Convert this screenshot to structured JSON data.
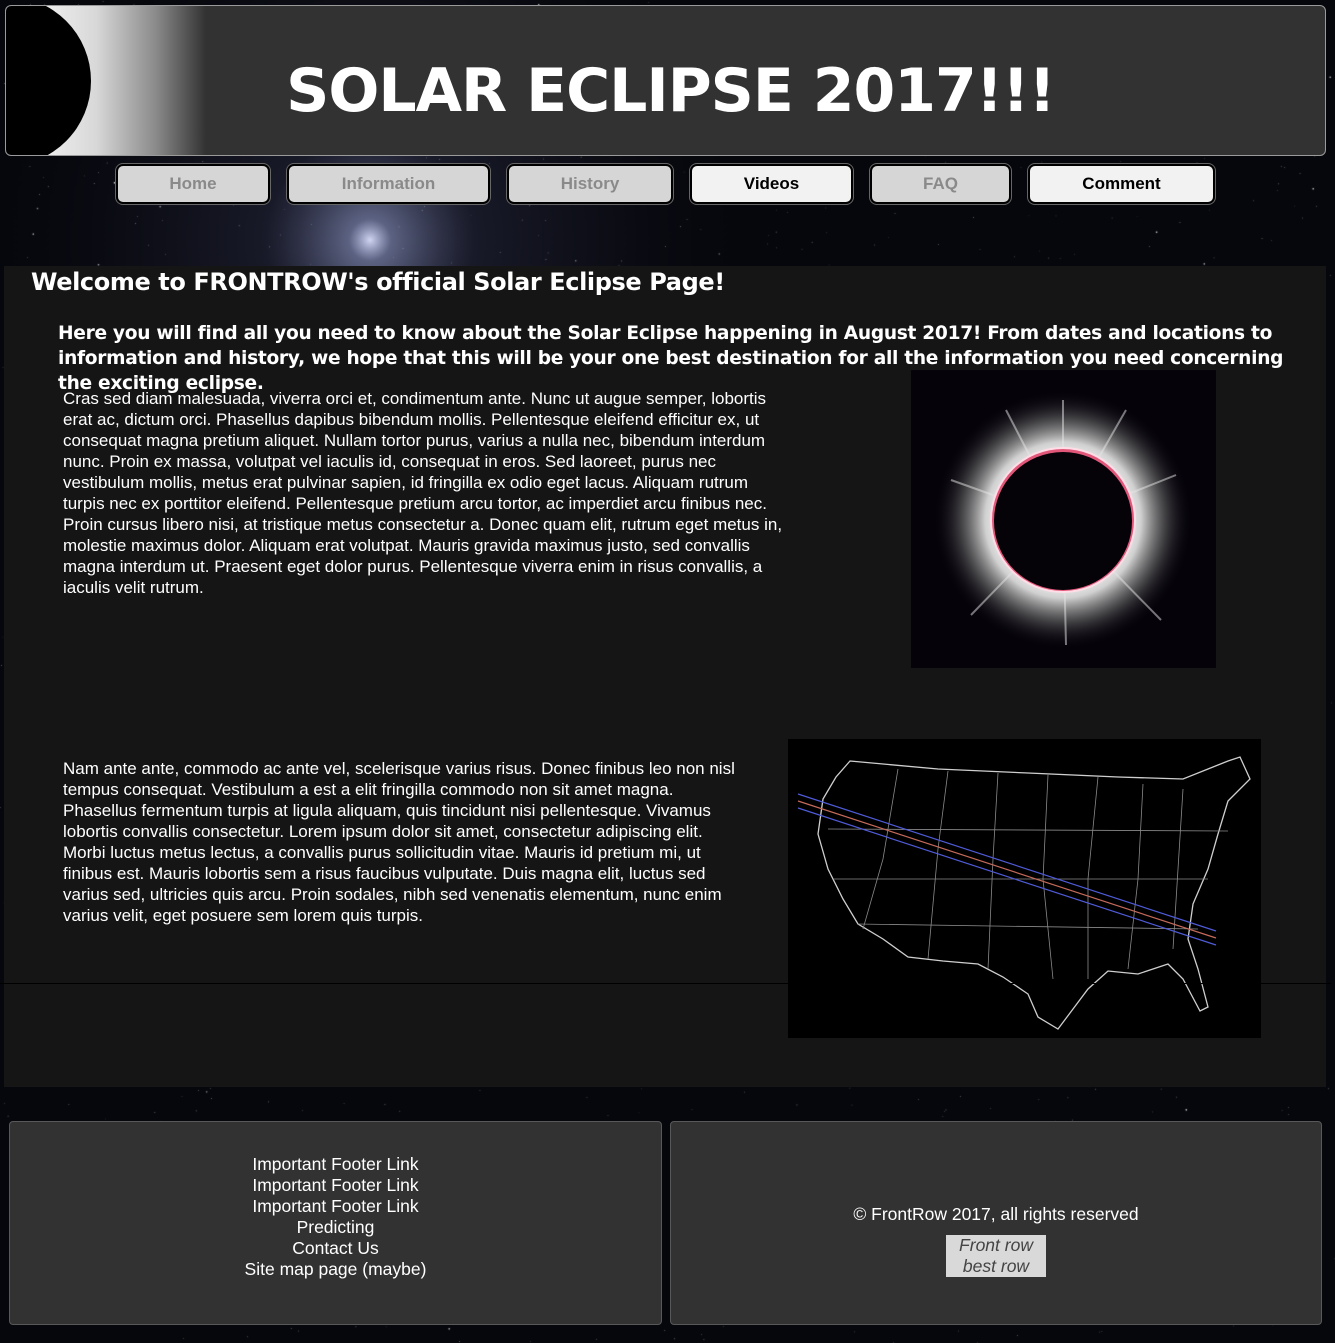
{
  "header": {
    "title": "SOLAR ECLIPSE 2017!!!"
  },
  "nav": {
    "items": [
      {
        "label": "Home"
      },
      {
        "label": "Information"
      },
      {
        "label": "History"
      },
      {
        "label": "Videos"
      },
      {
        "label": "FAQ"
      },
      {
        "label": "Comment"
      }
    ]
  },
  "main": {
    "welcome": "Welcome to FRONTROW's official Solar Eclipse Page!",
    "intro": "Here you will find all you need to know about the Solar Eclipse happening in August 2017! From dates and locations to information and history, we hope that this will be your one best destination for all the information you need concerning the exciting eclipse.",
    "paragraph1": "Cras sed diam malesuada, viverra orci et, condimentum ante. Nunc ut augue semper, lobortis erat ac, dictum orci. Phasellus dapibus bibendum mollis. Pellentesque eleifend efficitur ex, ut consequat magna pretium aliquet. Nullam tortor purus, varius a nulla nec, bibendum interdum nunc. Proin ex massa, volutpat vel iaculis id, consequat in eros. Sed laoreet, purus nec vestibulum mollis, metus erat pulvinar sapien, id fringilla ex odio eget lacus. Aliquam rutrum turpis nec ex porttitor eleifend. Pellentesque pretium arcu tortor, ac imperdiet arcu finibus nec. Proin cursus libero nisi, at tristique metus consectetur a. Donec quam elit, rutrum eget metus in, molestie maximus dolor. Aliquam erat volutpat. Mauris gravida maximus justo, sed convallis magna interdum ut. Praesent eget dolor purus. Pellentesque viverra enim in risus convallis, a iaculis velit rutrum.",
    "paragraph2": "Nam ante ante, commodo ac ante vel, scelerisque varius risus. Donec finibus leo non nisl tempus consequat. Vestibulum a est a elit fringilla commodo non sit amet magna. Phasellus fermentum turpis at ligula aliquam, quis tincidunt nisi pellentesque. Vivamus lobortis convallis consectetur. Lorem ipsum dolor sit amet, consectetur adipiscing elit. Morbi luctus metus lectus, a convallis purus sollicitudin vitae. Mauris id pretium mi, ut finibus est. Mauris lobortis sem a risus faucibus vulputate. Duis magna elit, luctus sed varius sed, ultricies quis arcu. Proin sodales, nibh sed venenatis elementum, nunc enim varius velit, eget posuere sem lorem quis turpis."
  },
  "footer": {
    "links": [
      "Important Footer Link",
      "Important Footer Link",
      "Important Footer Link",
      "Predicting",
      "Contact Us",
      "Site map page (maybe)"
    ],
    "copyright": "© FrontRow 2017, all rights reserved",
    "tagline_line1": "Front row",
    "tagline_line2": "best row"
  },
  "colors": {
    "header_bg": "#323232",
    "panel_bg": "#151515",
    "nav_dim_bg": "#d6d6d6",
    "nav_lit_bg": "#f2f2f2"
  }
}
